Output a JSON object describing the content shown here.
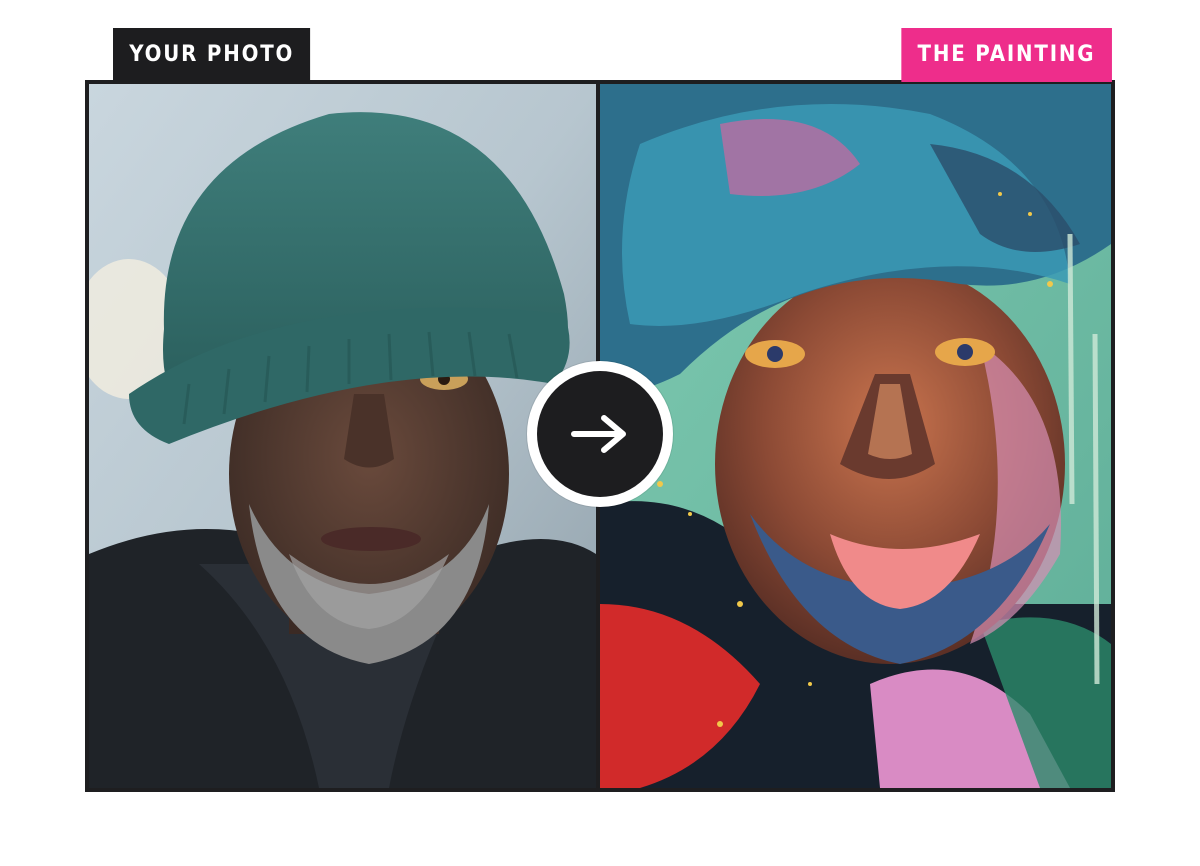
{
  "labels": {
    "photo": "YOUR PHOTO",
    "painting": "THE PAINTING"
  },
  "images": {
    "photo": "portrait-photo",
    "painting": "portrait-painting"
  },
  "icons": {
    "transform": "arrow-right-icon"
  },
  "colors": {
    "photo_label_bg": "#1d1d1f",
    "painting_label_bg": "#ee2d8b",
    "frame": "#1e1e20"
  }
}
